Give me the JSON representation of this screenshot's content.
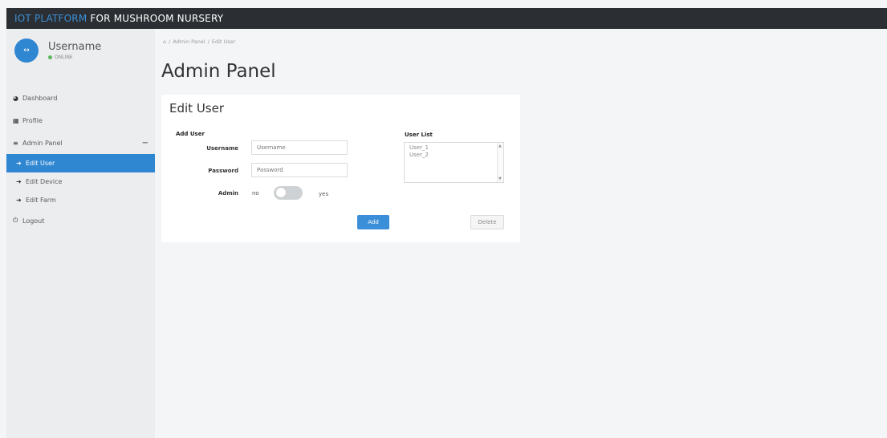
{
  "header": {
    "brand_accent": "IOT PLATFORM",
    "brand_rest": " FOR MUSHROOM NURSERY"
  },
  "user": {
    "name": "Username",
    "status": "ONLINE",
    "avatar_glyph": "↔"
  },
  "sidebar": {
    "items": [
      {
        "label": "Dashboard",
        "icon": "dashboard-icon"
      },
      {
        "label": "Profile",
        "icon": "calendar-icon"
      },
      {
        "label": "Admin Panel",
        "icon": "list-icon",
        "toggle": "−"
      },
      {
        "label": "Edit User",
        "icon": "arrow-right-icon",
        "active": true
      },
      {
        "label": "Edit Device",
        "icon": "arrow-right-icon"
      },
      {
        "label": "Edit Farm",
        "icon": "arrow-right-icon"
      },
      {
        "label": "Logout",
        "icon": "power-icon"
      }
    ]
  },
  "breadcrumb": {
    "items": [
      "Admin Panel",
      "Edit User"
    ],
    "separator": "/"
  },
  "page": {
    "title": "Admin Panel"
  },
  "form": {
    "title": "Edit User",
    "add_user_label": "Add User",
    "username_label": "Username",
    "username_placeholder": "Username",
    "password_label": "Password",
    "password_placeholder": "Password",
    "admin_label": "Admin",
    "toggle_off_label": "no",
    "toggle_on_label": "yes",
    "add_button": "Add",
    "user_list_label": "User List",
    "users": [
      "User_1",
      "User_2"
    ],
    "delete_button": "Delete"
  },
  "colors": {
    "accent": "#2f86d1",
    "topbar": "#2b2f33",
    "online": "#5cb85c"
  }
}
